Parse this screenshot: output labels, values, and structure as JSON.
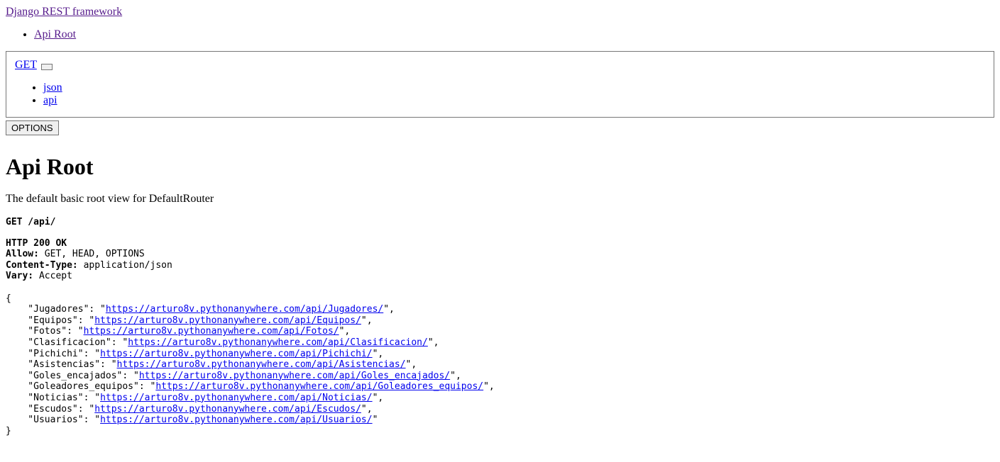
{
  "brand": "Django REST framework",
  "breadcrumb": "Api Root",
  "get_button": "GET",
  "formats": [
    "json",
    "api"
  ],
  "options_button": "OPTIONS",
  "title": "Api Root",
  "description": "The default basic root view for DefaultRouter",
  "request_line": "GET /api/",
  "status_line": "HTTP 200 OK",
  "headers": {
    "allow_label": "Allow:",
    "allow_value": " GET, HEAD, OPTIONS",
    "ctype_label": "Content-Type:",
    "ctype_value": " application/json",
    "vary_label": "Vary:",
    "vary_value": " Accept"
  },
  "endpoints": [
    {
      "key": "Jugadores",
      "url": "https://arturo8v.pythonanywhere.com/api/Jugadores/"
    },
    {
      "key": "Equipos",
      "url": "https://arturo8v.pythonanywhere.com/api/Equipos/"
    },
    {
      "key": "Fotos",
      "url": "https://arturo8v.pythonanywhere.com/api/Fotos/"
    },
    {
      "key": "Clasificacion",
      "url": "https://arturo8v.pythonanywhere.com/api/Clasificacion/"
    },
    {
      "key": "Pichichi",
      "url": "https://arturo8v.pythonanywhere.com/api/Pichichi/"
    },
    {
      "key": "Asistencias",
      "url": "https://arturo8v.pythonanywhere.com/api/Asistencias/"
    },
    {
      "key": "Goles_encajados",
      "url": "https://arturo8v.pythonanywhere.com/api/Goles_encajados/"
    },
    {
      "key": "Goleadores_equipos",
      "url": "https://arturo8v.pythonanywhere.com/api/Goleadores_equipos/"
    },
    {
      "key": "Noticias",
      "url": "https://arturo8v.pythonanywhere.com/api/Noticias/"
    },
    {
      "key": "Escudos",
      "url": "https://arturo8v.pythonanywhere.com/api/Escudos/"
    },
    {
      "key": "Usuarios",
      "url": "https://arturo8v.pythonanywhere.com/api/Usuarios/"
    }
  ]
}
